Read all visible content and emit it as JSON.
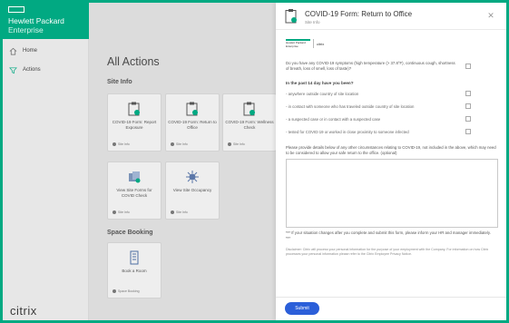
{
  "brand": {
    "line1": "Hewlett Packard",
    "line2": "Enterprise"
  },
  "nav": {
    "home": {
      "label": "Home",
      "icon": "home-icon"
    },
    "actions": {
      "label": "Actions",
      "icon": "filter-icon"
    }
  },
  "footer_logo": "citrix",
  "main": {
    "title": "All Actions",
    "section_site_info": "Site Info",
    "section_space_booking": "Space Booking",
    "cards": [
      {
        "title": "COVID-19 Form: Report Exposure",
        "tag": "Site Info",
        "icon": "form-check-icon"
      },
      {
        "title": "COVID-19 Form: Return to Office",
        "tag": "Site Info",
        "icon": "form-check-icon"
      },
      {
        "title": "COVID-19 Form: Wellness Check",
        "tag": "Site Info",
        "icon": "form-check-icon"
      },
      {
        "title": "View Site Forms for COVID Check",
        "tag": "Site Info",
        "icon": "forms-icon"
      },
      {
        "title": "View Site Occupancy",
        "tag": "Site Info",
        "icon": "virus-icon"
      },
      {
        "title": "Book a Room",
        "tag": "Space Booking",
        "icon": "building-icon"
      }
    ]
  },
  "panel": {
    "title": "COVID-19 Form: Return to Office",
    "subtitle": "Site Info",
    "logo_text": "Hewlett Packard Enterprise",
    "logo_citrix": "citrix",
    "question_main": "Do you have any COVID-19 symptoms (high temperature (> 37.8°F), continuous cough, shortness of breath, loss of smell, loss of taste)?",
    "question_head": "In the past 14 day have you been?",
    "items": [
      "- anywhere outside country of site location",
      "- in contact with someone who has traveled outside country of site location",
      "- a suspected case or in contact with a suspected case",
      "- tested for COVID-19 or worked in close proximity to someone infected"
    ],
    "details_label": "Please provide details below of any other circumstances relating to COVID-19, not included in the above, which may need to be considered to allow your safe return to the office. (optional)",
    "notice": "*** If your situation changes after you complete and submit this form, please inform your HR and manager immediately. ***",
    "disclaimer": "Disclaimer: Citrix will process your personal information for the purpose of your employment with the Company. For information on how Citrix processes your personal information please refer to the Citrix Employee Privacy Notice.",
    "submit_label": "Submit"
  },
  "colors": {
    "accent": "#01a982",
    "submit": "#2b5fd9"
  }
}
